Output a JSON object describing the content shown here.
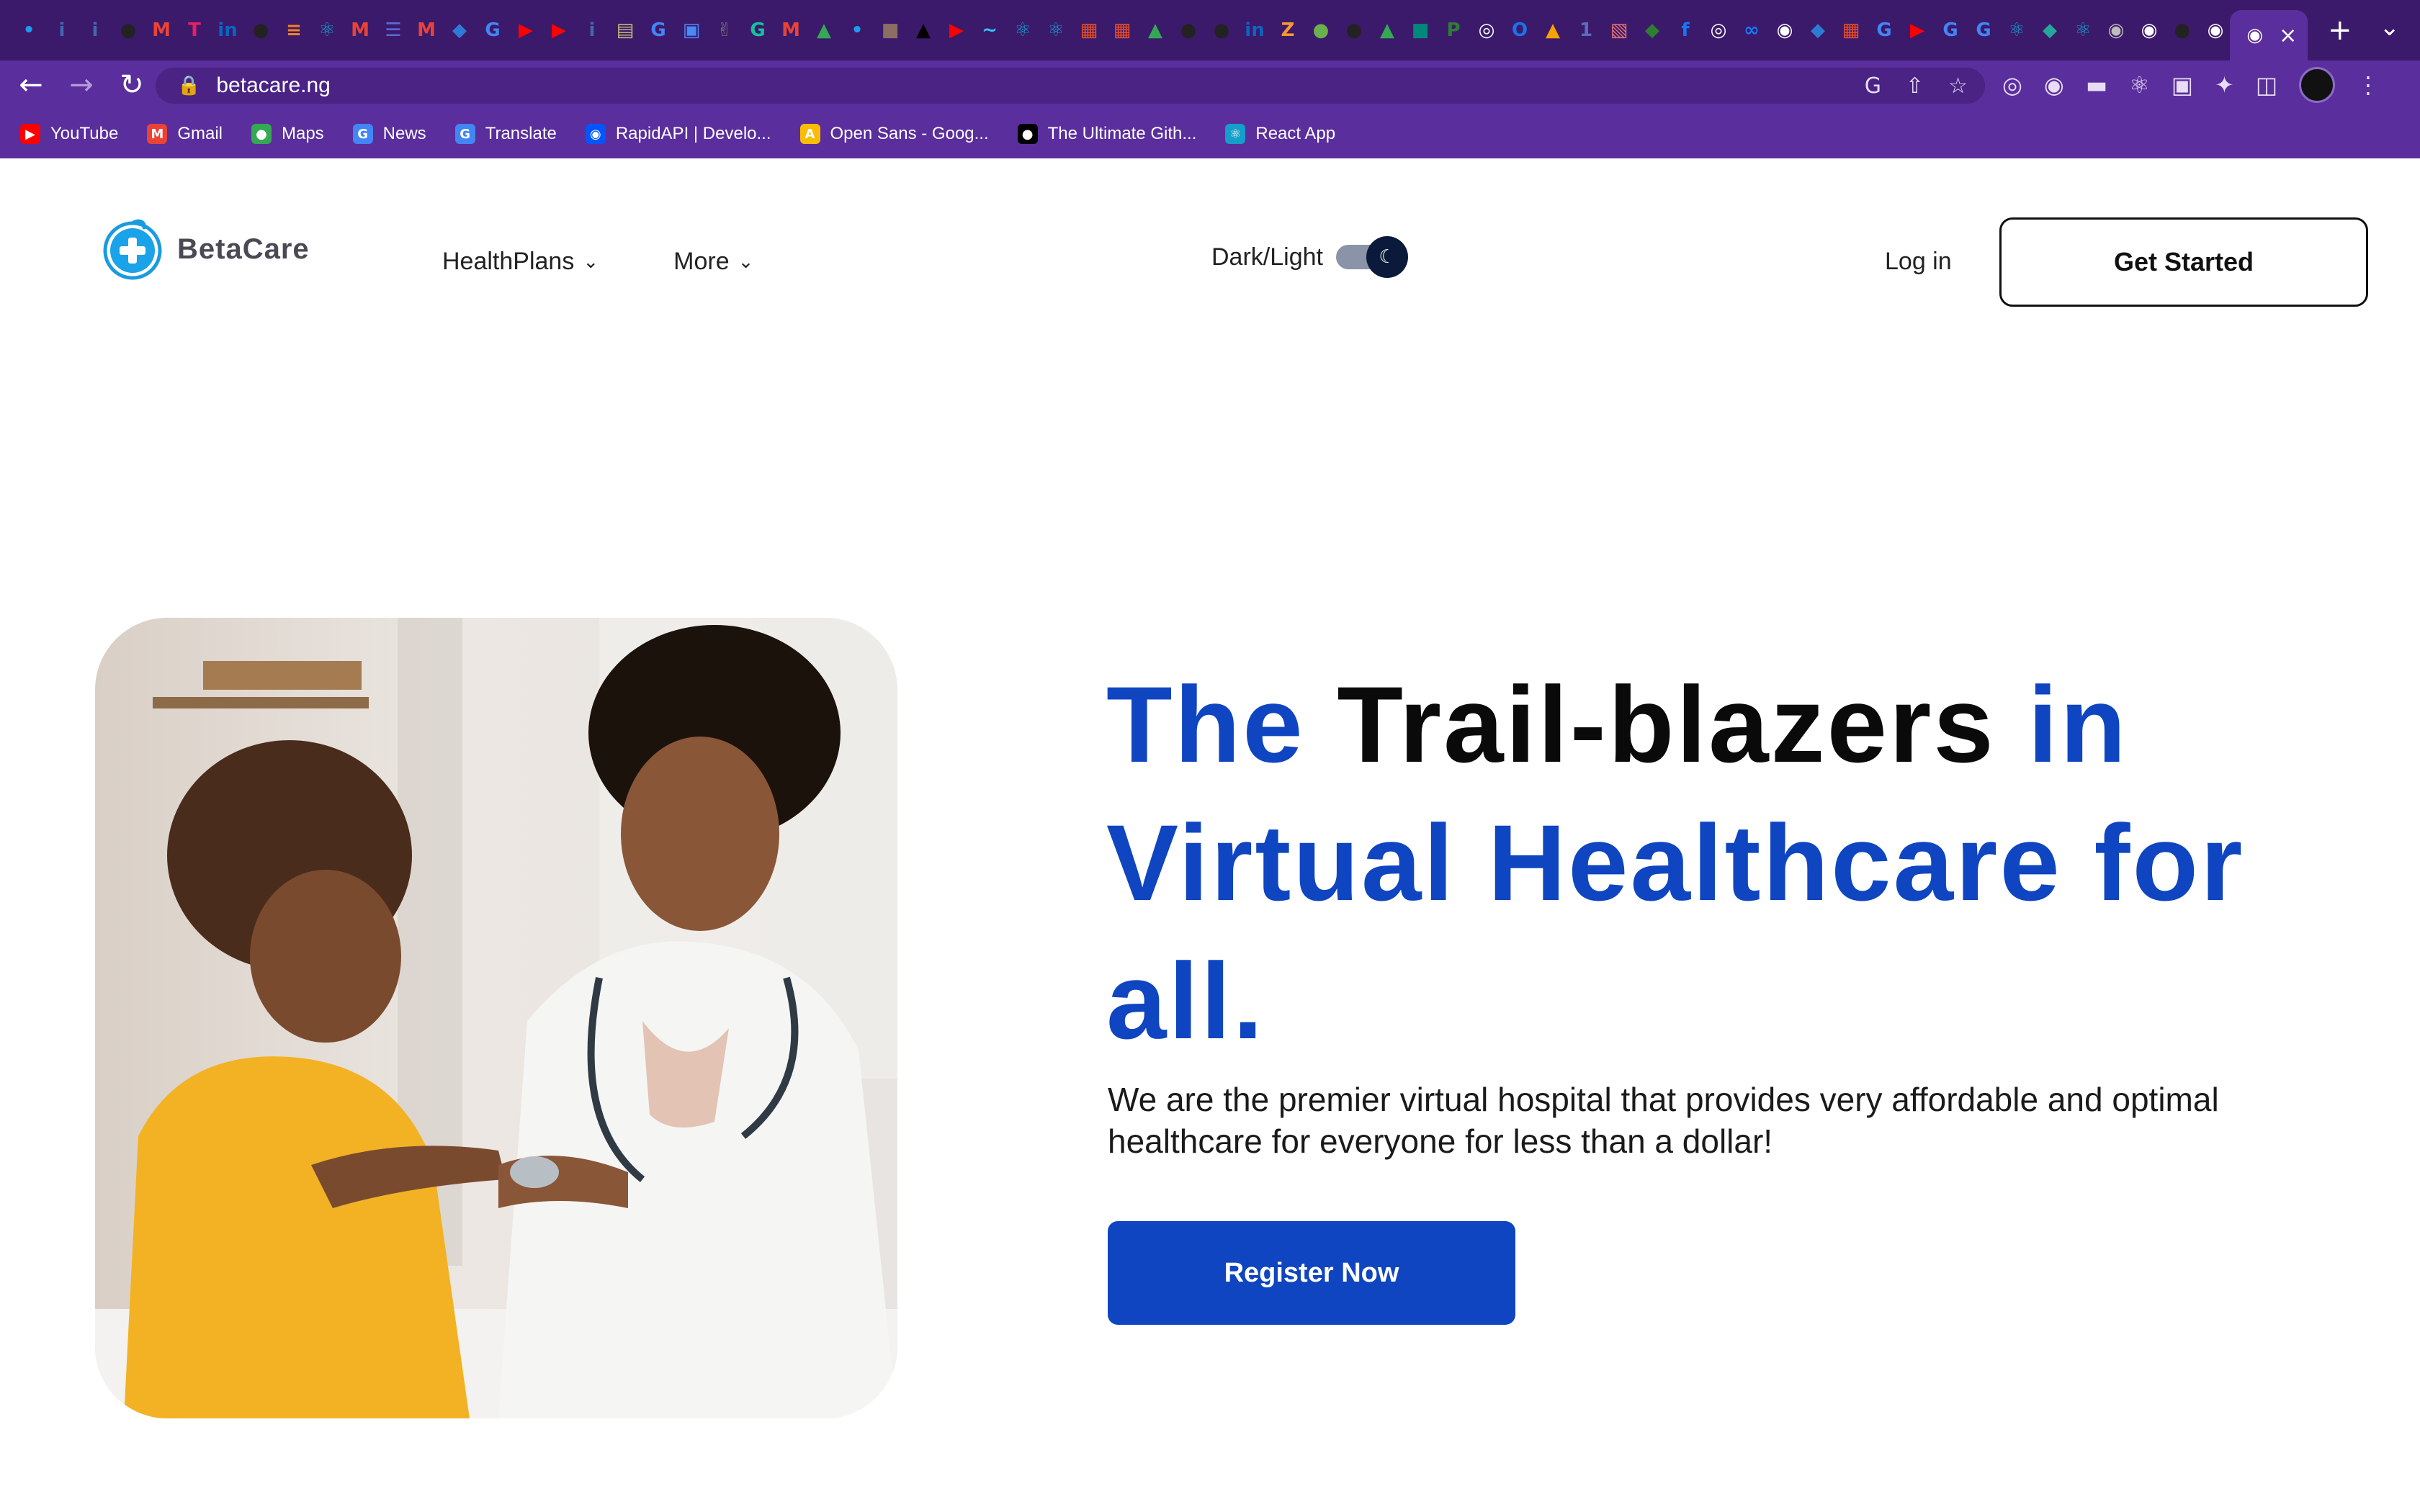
{
  "browser": {
    "tab_favicons": [
      {
        "icon": "twitter-icon",
        "glyph": "•",
        "color": "#1d9bf0"
      },
      {
        "icon": "info-icon",
        "glyph": "i",
        "color": "#4267b2"
      },
      {
        "icon": "info-icon",
        "glyph": "i",
        "color": "#4267b2"
      },
      {
        "icon": "github-icon",
        "glyph": "●",
        "color": "#222222"
      },
      {
        "icon": "gmail-icon",
        "glyph": "M",
        "color": "#ea4335"
      },
      {
        "icon": "t-icon",
        "glyph": "T",
        "color": "#e91e63"
      },
      {
        "icon": "linkedin-icon",
        "glyph": "in",
        "color": "#0a66c2"
      },
      {
        "icon": "github-icon",
        "glyph": "●",
        "color": "#222222"
      },
      {
        "icon": "stackoverflow-icon",
        "glyph": "≡",
        "color": "#f48024"
      },
      {
        "icon": "react-icon",
        "glyph": "⚛",
        "color": "#149eca"
      },
      {
        "icon": "gmail-icon",
        "glyph": "M",
        "color": "#ea4335"
      },
      {
        "icon": "list-icon",
        "glyph": "☰",
        "color": "#5b6bd6"
      },
      {
        "icon": "gmail-icon",
        "glyph": "M",
        "color": "#ea4335"
      },
      {
        "icon": "vscode-icon",
        "glyph": "◆",
        "color": "#2e7bd6"
      },
      {
        "icon": "google-icon",
        "glyph": "G",
        "color": "#4285f4"
      },
      {
        "icon": "youtube-icon",
        "glyph": "▶",
        "color": "#ff0000"
      },
      {
        "icon": "youtube-icon",
        "glyph": "▶",
        "color": "#ff0000"
      },
      {
        "icon": "info-icon",
        "glyph": "i",
        "color": "#4267b2"
      },
      {
        "icon": "document-icon",
        "glyph": "▤",
        "color": "#c9c27a"
      },
      {
        "icon": "google-icon",
        "glyph": "G",
        "color": "#4285f4"
      },
      {
        "icon": "store-icon",
        "glyph": "▣",
        "color": "#4a8af4"
      },
      {
        "icon": "peace-icon",
        "glyph": "✌",
        "color": "#777777"
      },
      {
        "icon": "grammarly-icon",
        "glyph": "G",
        "color": "#15c39a"
      },
      {
        "icon": "gmail-icon",
        "glyph": "M",
        "color": "#ea4335"
      },
      {
        "icon": "drive-icon",
        "glyph": "▲",
        "color": "#34a853"
      },
      {
        "icon": "twitter-icon",
        "glyph": "•",
        "color": "#1d9bf0"
      },
      {
        "icon": "image-icon",
        "glyph": "■",
        "color": "#8d6e63"
      },
      {
        "icon": "triangle-icon",
        "glyph": "▲",
        "color": "#000000"
      },
      {
        "icon": "youtube-icon",
        "glyph": "▶",
        "color": "#ff0000"
      },
      {
        "icon": "tailwind-icon",
        "glyph": "∼",
        "color": "#38bdf8"
      },
      {
        "icon": "react-icon",
        "glyph": "⚛",
        "color": "#149eca"
      },
      {
        "icon": "react-icon",
        "glyph": "⚛",
        "color": "#149eca"
      },
      {
        "icon": "microsoft-icon",
        "glyph": "▦",
        "color": "#f25022"
      },
      {
        "icon": "microsoft-icon",
        "glyph": "▦",
        "color": "#f25022"
      },
      {
        "icon": "drive-icon",
        "glyph": "▲",
        "color": "#34a853"
      },
      {
        "icon": "github-icon",
        "glyph": "●",
        "color": "#222222"
      },
      {
        "icon": "github-icon",
        "glyph": "●",
        "color": "#222222"
      },
      {
        "icon": "linkedin-icon",
        "glyph": "in",
        "color": "#0a66c2"
      },
      {
        "icon": "zeplin-icon",
        "glyph": "Z",
        "color": "#f69833"
      },
      {
        "icon": "circle-icon",
        "glyph": "●",
        "color": "#6ab04c"
      },
      {
        "icon": "github-icon",
        "glyph": "●",
        "color": "#222222"
      },
      {
        "icon": "drive-icon",
        "glyph": "▲",
        "color": "#34a853"
      },
      {
        "icon": "meet-icon",
        "glyph": "■",
        "color": "#00897b"
      },
      {
        "icon": "pl-icon",
        "glyph": "P",
        "color": "#2e7d32"
      },
      {
        "icon": "globe-icon",
        "glyph": "◎",
        "color": "#ffffff"
      },
      {
        "icon": "o-icon",
        "glyph": "O",
        "color": "#1a73e8"
      },
      {
        "icon": "bookmark-icon",
        "glyph": "▲",
        "color": "#f4a300"
      },
      {
        "icon": "counter-icon",
        "glyph": "1",
        "color": "#5c6bc0"
      },
      {
        "icon": "snippet-icon",
        "glyph": "▧",
        "color": "#e57373"
      },
      {
        "icon": "green-icon",
        "glyph": "◆",
        "color": "#2e7d32"
      },
      {
        "icon": "facebook-icon",
        "glyph": "f",
        "color": "#1877f2"
      },
      {
        "icon": "globe-icon",
        "glyph": "◎",
        "color": "#ffffff"
      },
      {
        "icon": "meta-icon",
        "glyph": "∞",
        "color": "#1877f2"
      },
      {
        "icon": "chrome-icon",
        "glyph": "◉",
        "color": "#ffffff"
      },
      {
        "icon": "vscode-icon",
        "glyph": "◆",
        "color": "#2e7bd6"
      },
      {
        "icon": "microsoft-icon",
        "glyph": "▦",
        "color": "#f25022"
      },
      {
        "icon": "google-icon",
        "glyph": "G",
        "color": "#4285f4"
      },
      {
        "icon": "youtube-icon",
        "glyph": "▶",
        "color": "#ff0000"
      },
      {
        "icon": "google-icon",
        "glyph": "G",
        "color": "#4285f4"
      },
      {
        "icon": "google-icon",
        "glyph": "G",
        "color": "#4285f4"
      },
      {
        "icon": "react-icon",
        "glyph": "⚛",
        "color": "#149eca"
      },
      {
        "icon": "diamond-icon",
        "glyph": "◆",
        "color": "#26a69a"
      },
      {
        "icon": "react-icon",
        "glyph": "⚛",
        "color": "#149eca"
      },
      {
        "icon": "chrome-icon",
        "glyph": "◉",
        "color": "#bdbdbd"
      },
      {
        "icon": "chrome-icon",
        "glyph": "◉",
        "color": "#ffffff"
      },
      {
        "icon": "github-icon",
        "glyph": "●",
        "color": "#222222"
      },
      {
        "icon": "chrome-icon",
        "glyph": "◉",
        "color": "#ffffff"
      }
    ],
    "active_tab_icon": "chrome-icon",
    "close_tab_glyph": "×",
    "new_tab_glyph": "+",
    "tab_list_glyph": "⌄",
    "nav": {
      "back": "←",
      "forward": "→",
      "reload": "↻"
    },
    "url": "betacare.ng",
    "bookmarks": [
      {
        "label": "YouTube",
        "icon": "youtube-icon",
        "glyph": "▶",
        "color": "#ff0000"
      },
      {
        "label": "Gmail",
        "icon": "gmail-icon",
        "glyph": "M",
        "color": "#ea4335"
      },
      {
        "label": "Maps",
        "icon": "maps-icon",
        "glyph": "●",
        "color": "#34a853"
      },
      {
        "label": "News",
        "icon": "news-icon",
        "glyph": "G",
        "color": "#4285f4"
      },
      {
        "label": "Translate",
        "icon": "translate-icon",
        "glyph": "G",
        "color": "#4285f4"
      },
      {
        "label": "RapidAPI | Develo...",
        "icon": "rapidapi-icon",
        "glyph": "◉",
        "color": "#0055ff"
      },
      {
        "label": "Open Sans - Goog...",
        "icon": "google-fonts-icon",
        "glyph": "A",
        "color": "#fbbc04"
      },
      {
        "label": "The Ultimate Gith...",
        "icon": "medium-icon",
        "glyph": "●",
        "color": "#000000"
      },
      {
        "label": "React App",
        "icon": "react-icon",
        "glyph": "⚛",
        "color": "#149eca"
      }
    ]
  },
  "site": {
    "brand": "BetaCare",
    "nav": [
      {
        "label": "HealthPlans"
      },
      {
        "label": "More"
      }
    ],
    "theme_toggle": {
      "label": "Dark/Light",
      "state": "dark"
    },
    "login": "Log in",
    "cta": "Get Started"
  },
  "hero": {
    "headline": [
      {
        "text": "The ",
        "color": "blue"
      },
      {
        "text": "Trail-blazers ",
        "color": "black"
      },
      {
        "text": "in Virtual Healthcare for all.",
        "color": "blue"
      }
    ],
    "subtext": "We are the premier virtual hospital that provides very affordable and optimal healthcare for everyone for less than a dollar!",
    "button": "Register Now"
  },
  "colors": {
    "brand_blue": "#0f45c0",
    "browser_frame": "#5a2e9c",
    "browser_tabstrip": "#3b1a6b"
  }
}
